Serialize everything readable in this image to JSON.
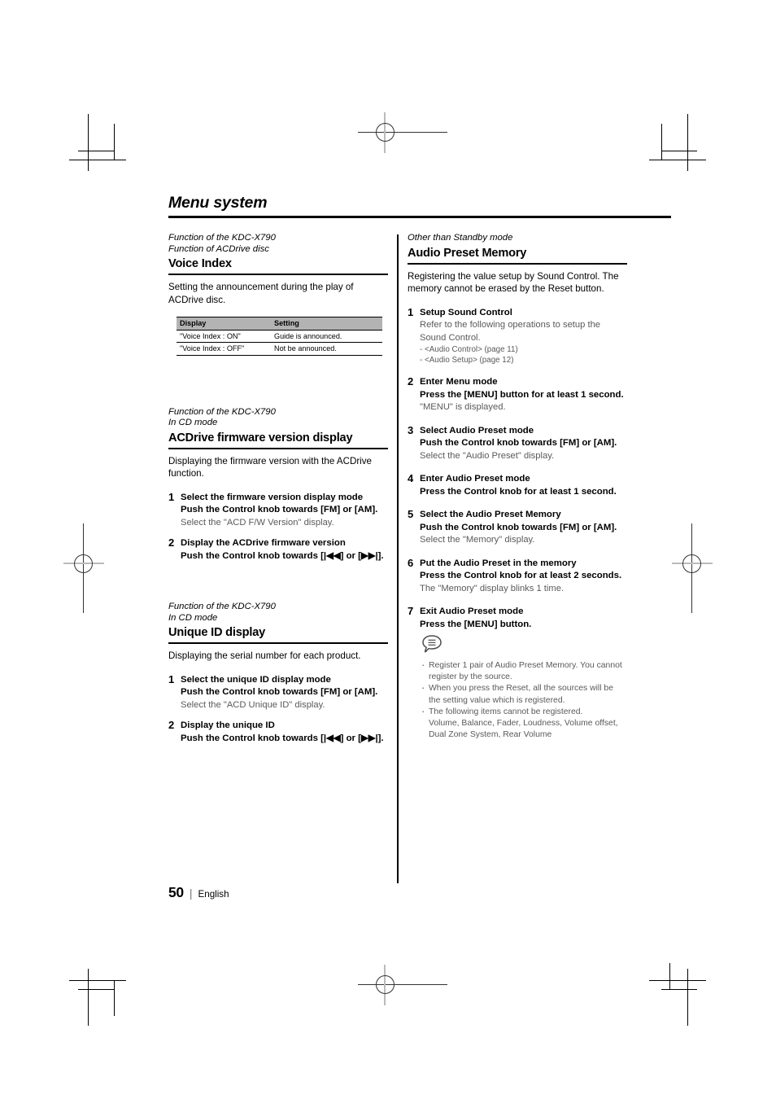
{
  "page": {
    "title": "Menu system",
    "number": "50",
    "separator": "|",
    "language": "English"
  },
  "left_column": {
    "sections": [
      {
        "eyebrow": "Function of the KDC-X790\nFunction of ACDrive disc",
        "heading": "Voice Index",
        "intro": "Setting the announcement during the play of ACDrive disc.",
        "table": {
          "headers": [
            "Display",
            "Setting"
          ],
          "rows": [
            [
              "\"Voice Index : ON\"",
              "Guide is announced."
            ],
            [
              "\"Voice Index : OFF\"",
              "Not be announced."
            ]
          ]
        }
      },
      {
        "eyebrow": "Function of the KDC-X790\nIn CD mode",
        "heading": "ACDrive firmware version display",
        "intro": "Displaying the firmware version with the ACDrive function.",
        "steps": [
          {
            "num": "1",
            "title": "Select the firmware version display mode",
            "action": "Push the Control knob towards [FM] or [AM].",
            "note": "Select the \"ACD F/W Version\" display."
          },
          {
            "num": "2",
            "title": "Display the ACDrive firmware version",
            "action": "Push the Control knob towards [|◀◀] or [▶▶|]."
          }
        ]
      },
      {
        "eyebrow": "Function of the KDC-X790\nIn CD mode",
        "heading": "Unique ID display",
        "intro": "Displaying the serial number for each product.",
        "steps": [
          {
            "num": "1",
            "title": "Select the unique ID display mode",
            "action": "Push the Control knob towards [FM] or [AM].",
            "note": "Select the \"ACD Unique ID\" display."
          },
          {
            "num": "2",
            "title": "Display the unique ID",
            "action": "Push the Control knob towards [|◀◀] or [▶▶|]."
          }
        ]
      }
    ]
  },
  "right_column": {
    "sections": [
      {
        "eyebrow": "Other than Standby mode",
        "heading": "Audio Preset Memory",
        "intro": "Registering the value setup by Sound Control. The memory cannot be erased by the Reset button.",
        "steps": [
          {
            "num": "1",
            "title": "Setup Sound Control",
            "note": "Refer to the following operations to setup the Sound Control.",
            "sublines": [
              "- <Audio Control> (page 11)",
              "- <Audio Setup> (page 12)"
            ]
          },
          {
            "num": "2",
            "title": "Enter Menu mode",
            "action": "Press the [MENU] button for at least 1 second.",
            "note": "\"MENU\" is displayed."
          },
          {
            "num": "3",
            "title": "Select Audio Preset mode",
            "action": "Push the Control knob towards [FM] or [AM].",
            "note": "Select the \"Audio Preset\" display."
          },
          {
            "num": "4",
            "title": "Enter Audio Preset mode",
            "action": "Press the Control knob for at least 1 second."
          },
          {
            "num": "5",
            "title": "Select the Audio Preset Memory",
            "action": "Push the Control knob towards [FM] or [AM].",
            "note": "Select the \"Memory\" display."
          },
          {
            "num": "6",
            "title": "Put the Audio Preset in the memory",
            "action": "Press the Control knob for at least 2 seconds.",
            "note": "The \"Memory\" display blinks 1 time."
          },
          {
            "num": "7",
            "title": "Exit Audio Preset mode",
            "action": "Press the [MENU] button."
          }
        ],
        "note_block": {
          "icon": "speech-bubble-note-icon",
          "items": [
            "Register 1 pair of Audio Preset Memory. You cannot register by the source.",
            "When you press the Reset, all the sources will be the setting value which is registered.",
            "The following items cannot be registered."
          ],
          "continuation": "Volume, Balance, Fader, Loudness, Volume offset, Dual Zone System, Rear Volume"
        }
      }
    ]
  }
}
